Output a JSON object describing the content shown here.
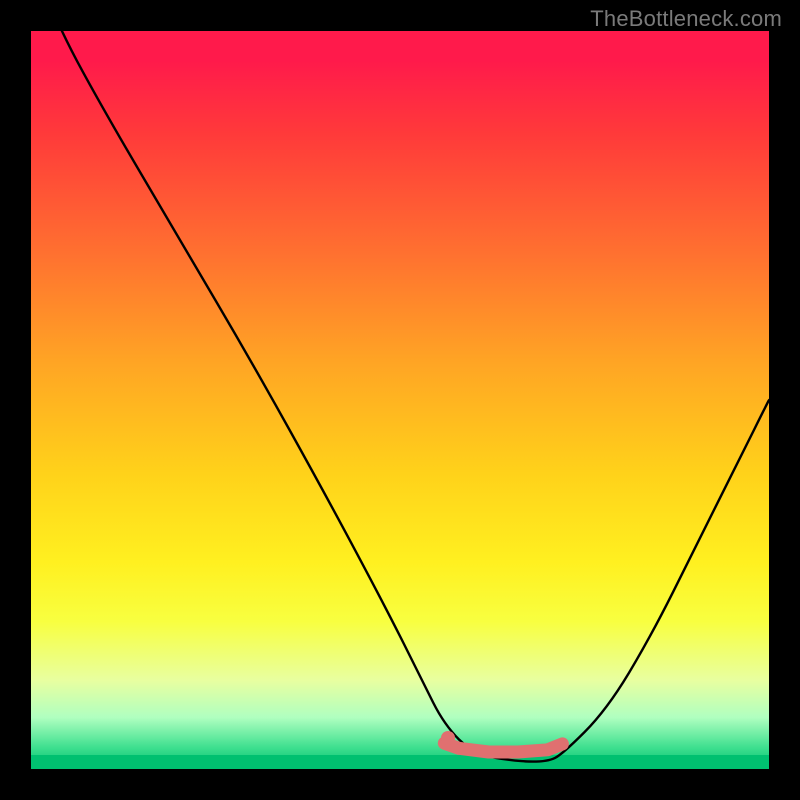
{
  "watermark": "TheBottleneck.com",
  "chart_data": {
    "type": "line",
    "title": "",
    "xlabel": "",
    "ylabel": "",
    "xlim": [
      0,
      100
    ],
    "ylim": [
      0,
      100
    ],
    "background_gradient": {
      "top": "#ff1a4b",
      "bottom": "#00c070",
      "stops": [
        "#ff1a4b",
        "#ff3a3a",
        "#ff7030",
        "#ffa524",
        "#ffd21a",
        "#fff020",
        "#f8ff40",
        "#e8ffa0",
        "#b0ffc0",
        "#40e090",
        "#00c070"
      ]
    },
    "series": [
      {
        "name": "curve",
        "color": "#000000",
        "x": [
          0,
          4,
          10,
          20,
          30,
          40,
          48,
          53,
          56,
          60,
          66,
          70,
          72,
          78,
          84,
          90,
          96,
          100
        ],
        "y": [
          110,
          100,
          89,
          72,
          55,
          37,
          22,
          12,
          6,
          2,
          1,
          1,
          2,
          8,
          18,
          30,
          42,
          50
        ]
      }
    ],
    "highlight_segment": {
      "name": "optimal-range",
      "color": "#e07070",
      "x": [
        56,
        58,
        62,
        66,
        70,
        72
      ],
      "y": [
        3.5,
        2.8,
        2.3,
        2.3,
        2.6,
        3.4
      ]
    },
    "highlight_dot": {
      "name": "optimal-point",
      "color": "#e07070",
      "x": 56.5,
      "y": 4.2
    }
  }
}
